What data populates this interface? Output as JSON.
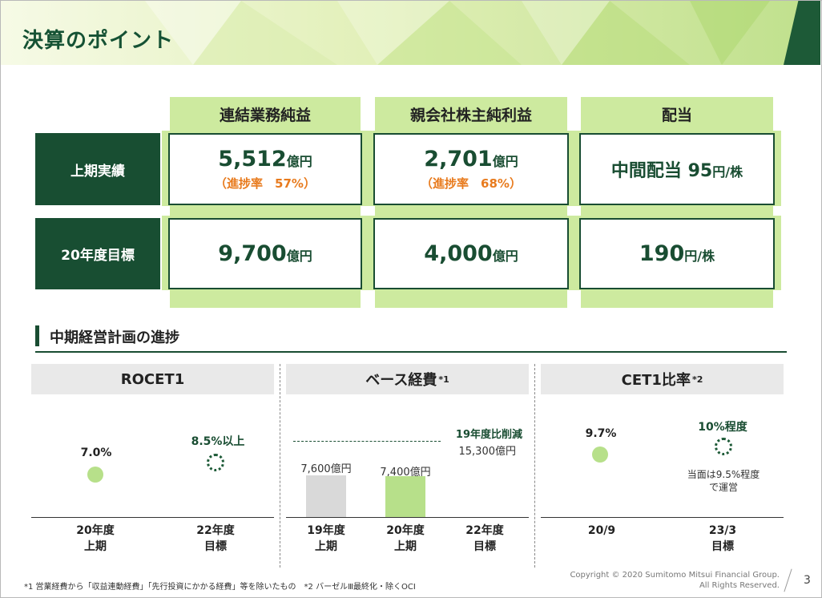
{
  "page": {
    "title": "決算のポイント",
    "page_number": "3"
  },
  "summary": {
    "columns": [
      "連結業務純益",
      "親会社株主純利益",
      "配当"
    ],
    "rows": [
      {
        "label": "上期実績",
        "cells": [
          {
            "value": "5,512",
            "unit": "億円",
            "rate": "（進捗率　57%）"
          },
          {
            "value": "2,701",
            "unit": "億円",
            "rate": "（進捗率　68%）"
          },
          {
            "prefix": "中間配当 ",
            "value": "95",
            "unit": "円/株"
          }
        ]
      },
      {
        "label": "20年度目標",
        "cells": [
          {
            "value": "9,700",
            "unit": "億円"
          },
          {
            "value": "4,000",
            "unit": "億円"
          },
          {
            "value": "190",
            "unit": "円/株"
          }
        ]
      }
    ]
  },
  "section": {
    "title": "中期経営計画の進捗"
  },
  "panels": [
    {
      "title": "ROCET1",
      "sup": "",
      "points": [
        {
          "value": "7.0%"
        },
        {
          "value": "8.5%以上"
        }
      ],
      "axis": [
        [
          "20年度",
          "上期"
        ],
        [
          "22年度",
          "目標"
        ]
      ]
    },
    {
      "title": "ベース経費",
      "sup": "*1",
      "bars": [
        {
          "label": "7,600億円",
          "value": 7600
        },
        {
          "label": "7,400億円",
          "value": 7400
        }
      ],
      "reduction_label": "19年度比削減",
      "reduction_value": "15,300億円",
      "axis": [
        [
          "19年度",
          "上期"
        ],
        [
          "20年度",
          "上期"
        ],
        [
          "22年度",
          "目標"
        ]
      ]
    },
    {
      "title": "CET1比率",
      "sup": "*2",
      "points": [
        {
          "value": "9.7%"
        },
        {
          "value": "10%程度"
        }
      ],
      "note": [
        "当面は9.5%程度",
        "で運営"
      ],
      "axis": [
        [
          "20/9",
          ""
        ],
        [
          "23/3",
          "目標"
        ]
      ]
    }
  ],
  "footnote": "*1 営業経費から「収益連動経費」「先行投資にかかる経費」等を除いたもの　*2 バーゼルⅢ最終化・除くOCI",
  "copyright": [
    "Copyright © 2020 Sumitomo Mitsui Financial Group.",
    "All Rights Reserved."
  ],
  "colors": {
    "dark_green": "#194d32",
    "light_green": "#cdea9f",
    "orange": "#e87b1e",
    "bar_gray": "#d9d9d9",
    "bar_green": "#b7e08a"
  }
}
